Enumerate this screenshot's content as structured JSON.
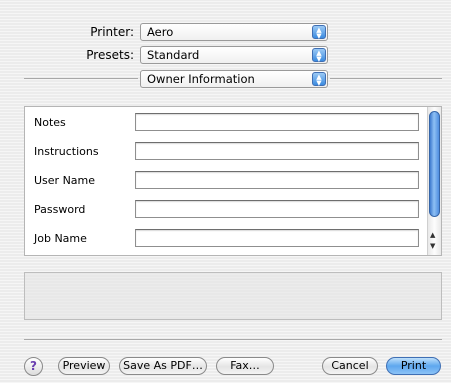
{
  "header": {
    "printer_label": "Printer:",
    "printer_value": "Aero",
    "presets_label": "Presets:",
    "presets_value": "Standard",
    "section_value": "Owner Information"
  },
  "fields": [
    {
      "label": "Notes",
      "value": ""
    },
    {
      "label": "Instructions",
      "value": ""
    },
    {
      "label": "User Name",
      "value": ""
    },
    {
      "label": "Password",
      "value": ""
    },
    {
      "label": "Job Name",
      "value": ""
    }
  ],
  "buttons": {
    "help": "?",
    "preview": "Preview",
    "save_pdf": "Save As PDF…",
    "fax": "Fax…",
    "cancel": "Cancel",
    "print": "Print"
  },
  "icons": {
    "popup_arrows": "updown-arrows-icon",
    "help": "help-icon"
  },
  "colors": {
    "accent": "#3b8be0",
    "background": "#ececec"
  }
}
